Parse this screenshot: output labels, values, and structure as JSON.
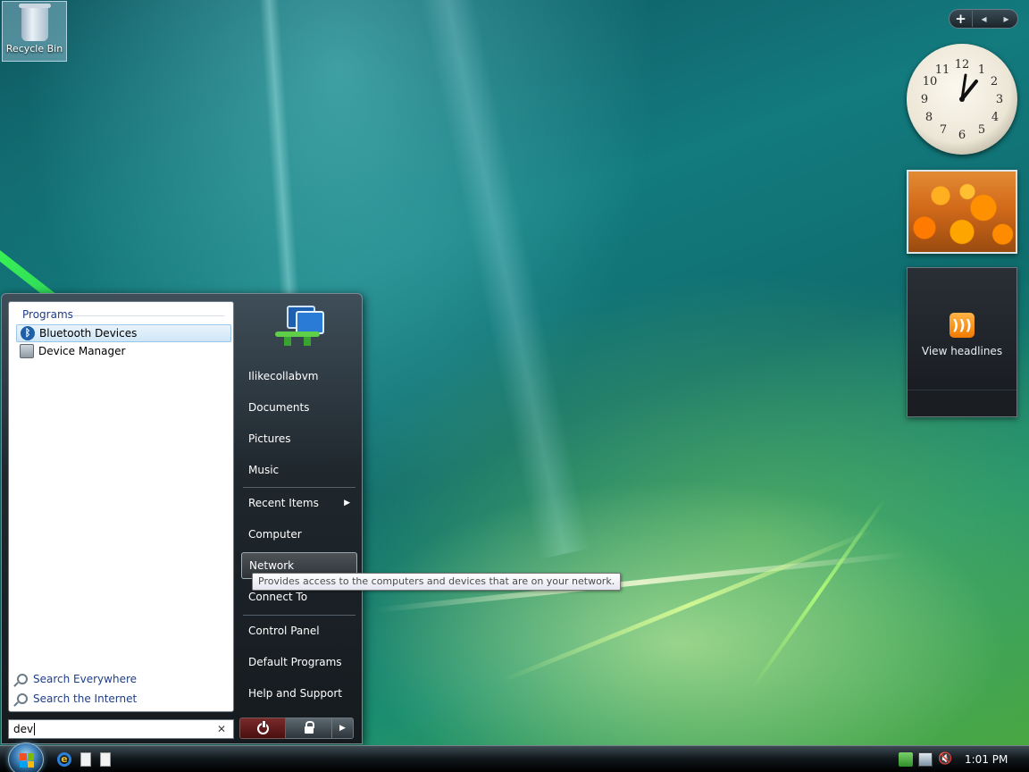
{
  "desktop": {
    "recycle_bin_label": "Recycle Bin"
  },
  "gadgets": {
    "feed_text": "View headlines",
    "clock_numbers": [
      "12",
      "1",
      "2",
      "3",
      "4",
      "5",
      "6",
      "7",
      "8",
      "9",
      "10",
      "11"
    ]
  },
  "start_menu": {
    "programs_header": "Programs",
    "programs": [
      {
        "label": "Bluetooth Devices",
        "icon": "bluetooth-icon"
      },
      {
        "label": "Device Manager",
        "icon": "device-manager-icon"
      }
    ],
    "search_everywhere": "Search Everywhere",
    "search_internet": "Search the Internet",
    "search_value": "dev",
    "right_items": [
      {
        "label": "Ilikecollabvm"
      },
      {
        "label": "Documents"
      },
      {
        "label": "Pictures"
      },
      {
        "label": "Music"
      },
      {
        "label": "Recent Items"
      },
      {
        "label": "Computer"
      },
      {
        "label": "Network"
      },
      {
        "label": "Connect To"
      },
      {
        "label": "Control Panel"
      },
      {
        "label": "Default Programs"
      },
      {
        "label": "Help and Support"
      }
    ],
    "tooltip": "Provides access to the computers and devices that are on your network."
  },
  "taskbar": {
    "time": "1:01 PM"
  }
}
